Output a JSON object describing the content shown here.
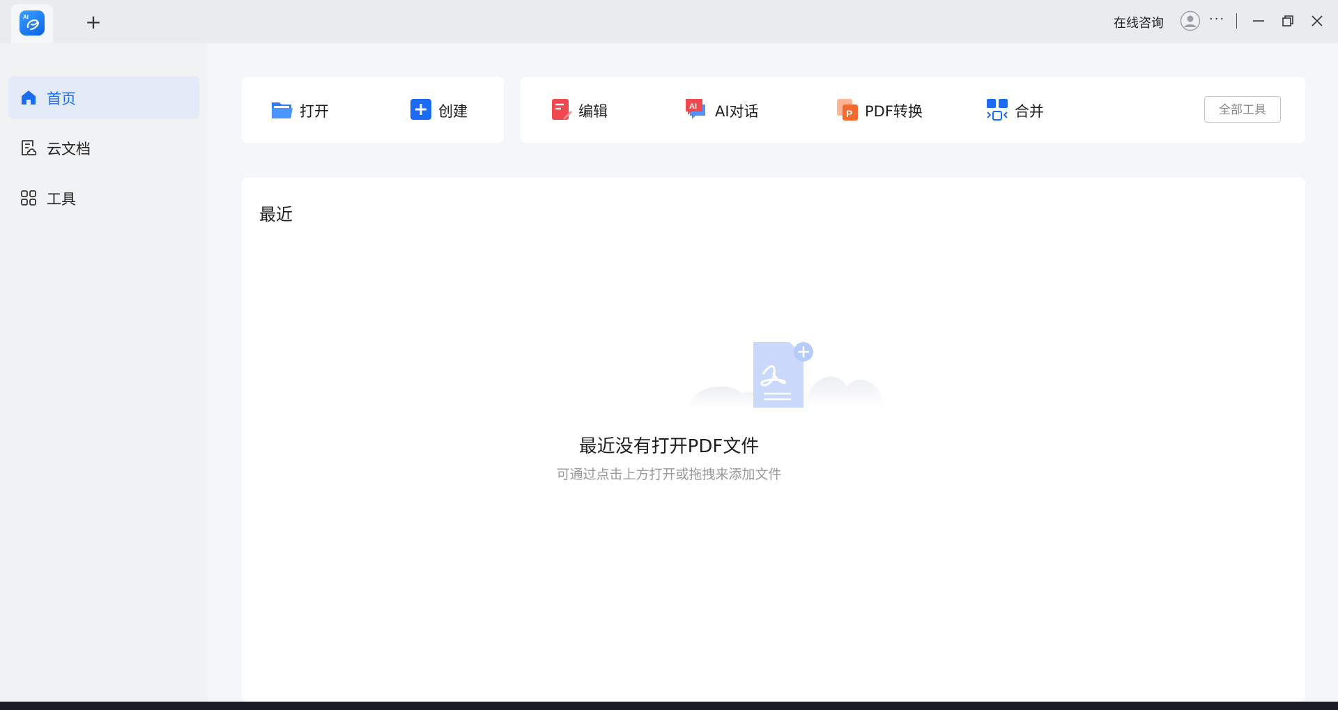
{
  "titlebar": {
    "new_tab_symbol": "+",
    "consult_label": "在线咨询",
    "more_symbol": "···",
    "logo_text": "AI"
  },
  "sidebar": {
    "items": [
      {
        "label": "首页",
        "icon": "home-icon",
        "active": true
      },
      {
        "label": "云文档",
        "icon": "cloud-doc-icon",
        "active": false
      },
      {
        "label": "工具",
        "icon": "tools-grid-icon",
        "active": false
      }
    ]
  },
  "toolbar": {
    "left": [
      {
        "label": "打开",
        "icon": "folder-icon"
      },
      {
        "label": "创建",
        "icon": "plus-square-icon"
      }
    ],
    "right": [
      {
        "label": "编辑",
        "icon": "edit-doc-icon"
      },
      {
        "label": "AI对话",
        "icon": "ai-chat-icon"
      },
      {
        "label": "PDF转换",
        "icon": "pdf-convert-icon"
      },
      {
        "label": "合并",
        "icon": "merge-icon"
      }
    ],
    "all_tools_label": "全部工具"
  },
  "recent": {
    "title": "最近",
    "empty_title": "最近没有打开PDF文件",
    "empty_subtitle": "可通过点击上方打开或拖拽来添加文件"
  },
  "colors": {
    "accent": "#1b6cf2",
    "sidebar_active_bg": "#e3ebf8",
    "edit_red": "#f0484f",
    "convert_orange": "#f26a2f"
  }
}
